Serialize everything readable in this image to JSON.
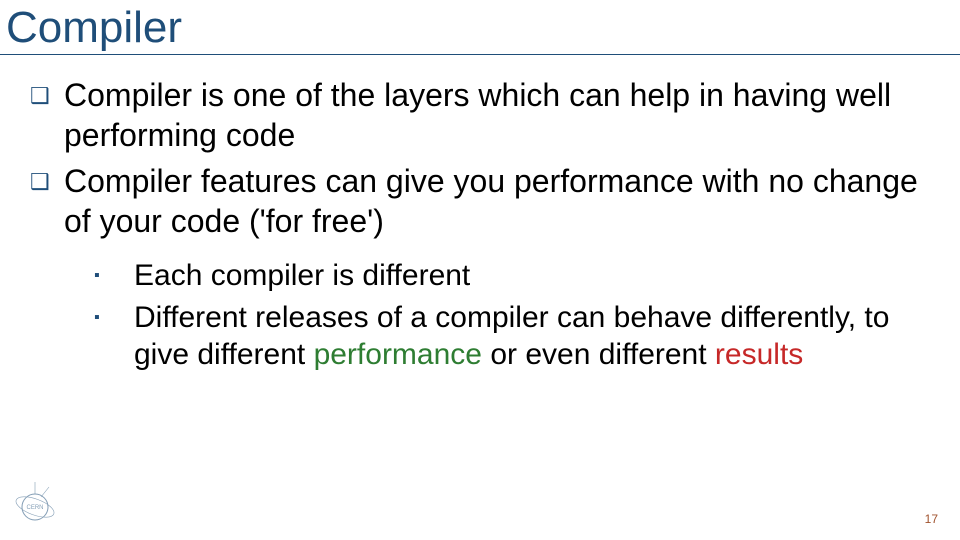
{
  "title": "Compiler",
  "bullets": [
    {
      "text": "Compiler is one of the layers which can help in having well performing code"
    },
    {
      "text": "Compiler features can give you performance with no change of your code ('for free')"
    }
  ],
  "subbullets": [
    {
      "text": "Each compiler is different"
    },
    {
      "pre": "Different releases of a compiler can behave differently, to give different ",
      "hl1": "performance",
      "mid": " or even different ",
      "hl2": "results"
    }
  ],
  "logo_label": "CERN",
  "page_number": "17"
}
